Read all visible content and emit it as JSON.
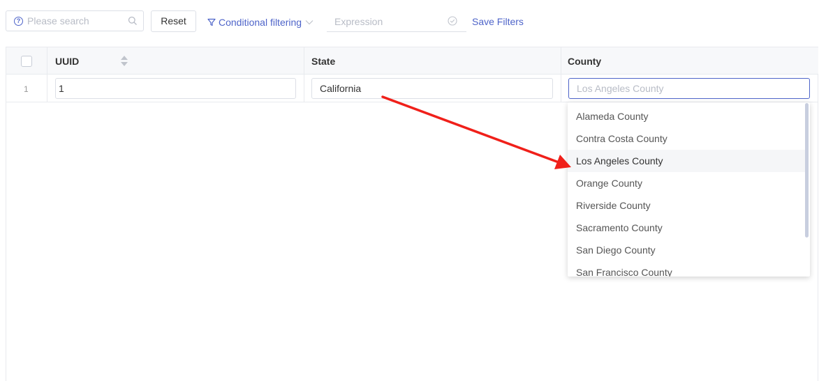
{
  "toolbar": {
    "search_placeholder": "Please search",
    "reset_label": "Reset",
    "conditional_filtering_label": "Conditional filtering",
    "expression_placeholder": "Expression",
    "save_filters_label": "Save Filters"
  },
  "grid": {
    "columns": [
      "UUID",
      "State",
      "County"
    ],
    "rows": [
      {
        "row_number": "1",
        "uuid": "1",
        "state": "California",
        "county_placeholder": "Los Angeles County"
      }
    ]
  },
  "county_dropdown": {
    "options": [
      "Alameda County",
      "Contra Costa County",
      "Los Angeles County",
      "Orange County",
      "Riverside County",
      "Sacramento County",
      "San Diego County",
      "San Francisco County"
    ],
    "highlighted": "Los Angeles County"
  },
  "colors": {
    "accent": "#4e64c9",
    "annotation_arrow": "#f0201a",
    "border": "#e8eaee"
  },
  "icons": {
    "help": "question-circle-icon",
    "search": "magnifier-icon",
    "filter": "funnel-icon",
    "dropdown": "chevron-down-icon",
    "expression_check": "check-circle-icon",
    "sort": "sort-icon"
  }
}
